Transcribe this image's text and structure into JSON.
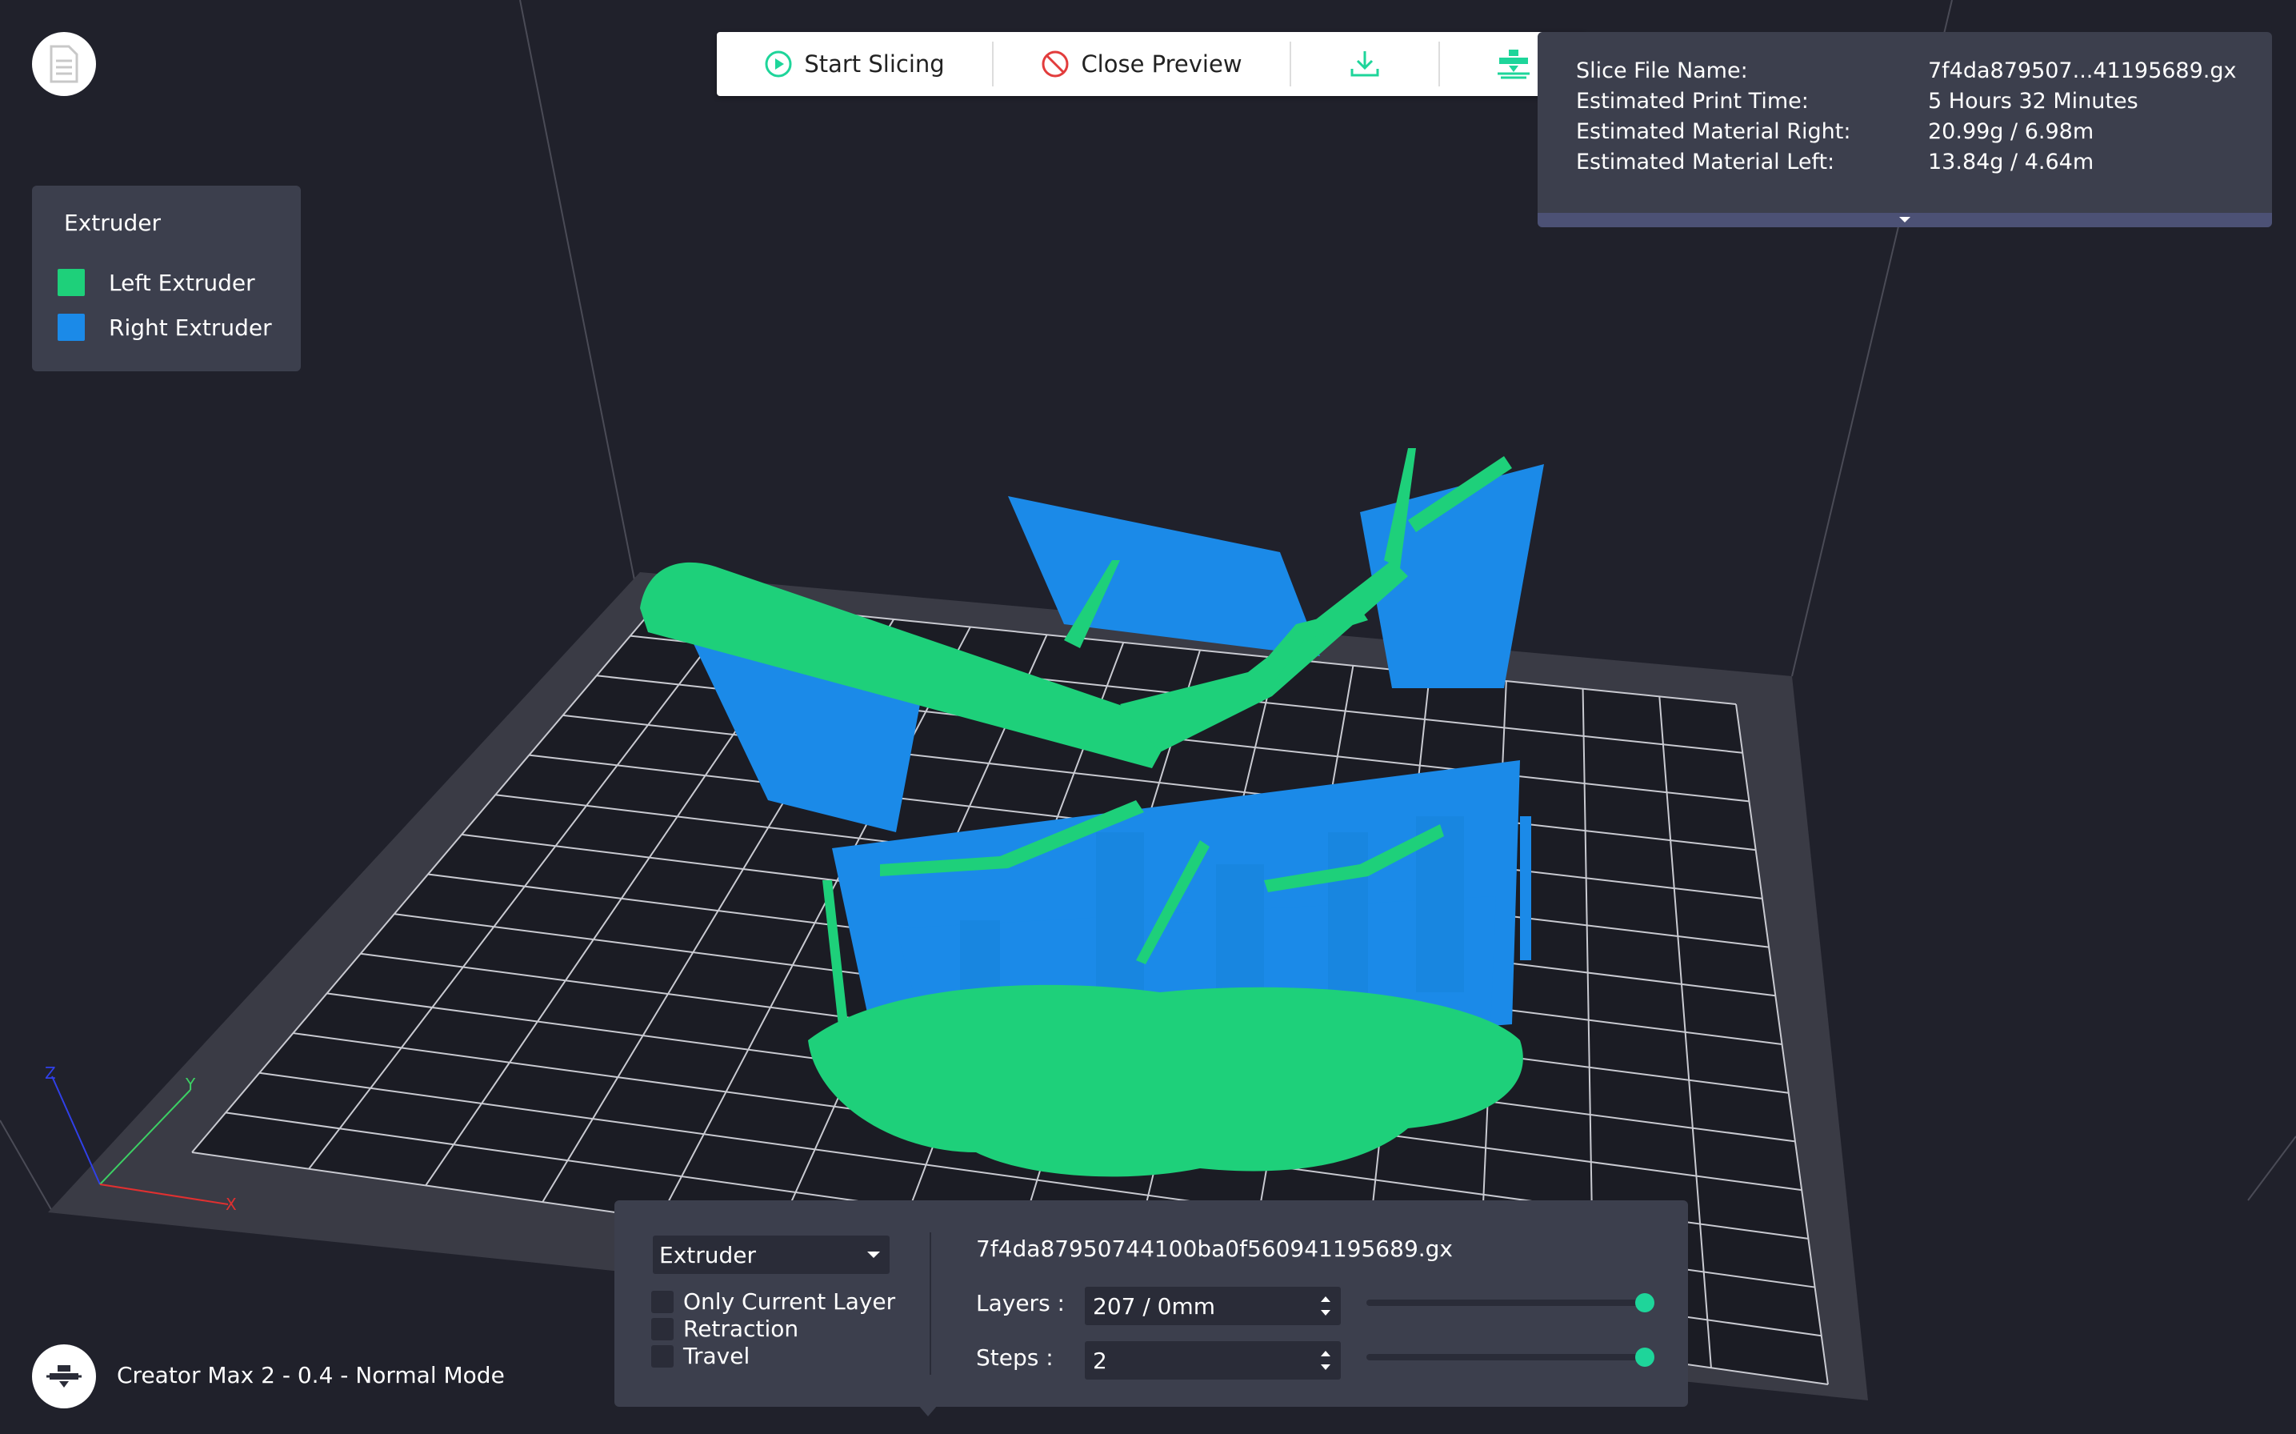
{
  "toolbar": {
    "start_slicing": "Start Slicing",
    "close_preview": "Close Preview"
  },
  "info": {
    "rows": [
      {
        "key": "Slice File Name:",
        "value": "7f4da879507...41195689.gx"
      },
      {
        "key": "Estimated Print Time:",
        "value": "5 Hours 32 Minutes"
      },
      {
        "key": "Estimated Material Right:",
        "value": "20.99g / 6.98m"
      },
      {
        "key": "Estimated Material Left:",
        "value": "13.84g / 4.64m"
      }
    ]
  },
  "legend": {
    "title": "Extruder",
    "items": [
      {
        "label": "Left Extruder",
        "color": "#1ed07a"
      },
      {
        "label": "Right Extruder",
        "color": "#1b8ae8"
      }
    ]
  },
  "machine": {
    "label": "Creator Max 2 - 0.4 - Normal Mode"
  },
  "preview": {
    "view_select": "Extruder",
    "options": [
      {
        "label": "Only Current Layer",
        "checked": false
      },
      {
        "label": "Retraction",
        "checked": false
      },
      {
        "label": "Travel",
        "checked": false
      }
    ],
    "filename": "7f4da87950744100ba0f560941195689.gx",
    "layers_label": "Layers :",
    "layers_value": "207 / 0mm",
    "steps_label": "Steps :",
    "steps_value": "2",
    "layers_fraction": 1.0,
    "steps_fraction": 1.0
  },
  "axes": {
    "x": "X",
    "y": "Y",
    "z": "Z"
  },
  "colors": {
    "background": "#20212b",
    "panel": "#3c3f4d",
    "bed": "#3a3b45",
    "accent": "#1ed59a",
    "left_extruder": "#1ed07a",
    "right_extruder": "#1b8ae8"
  }
}
